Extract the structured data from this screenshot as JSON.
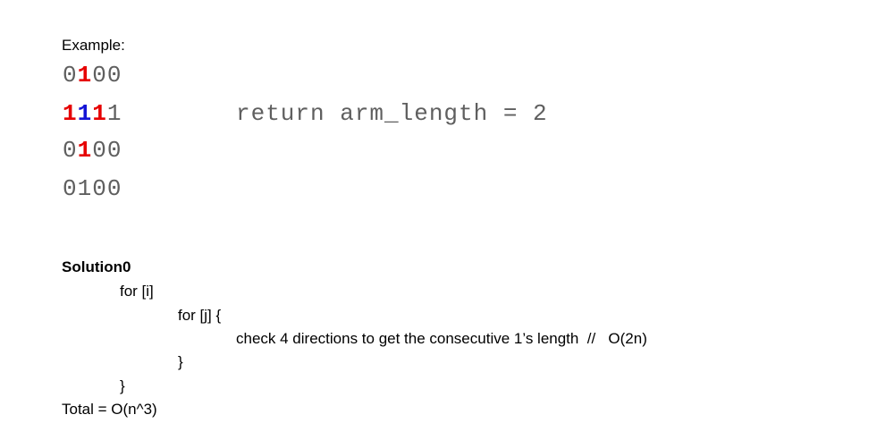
{
  "example": {
    "label": "Example:",
    "grid": [
      [
        {
          "v": "0",
          "c": "gray"
        },
        {
          "v": "1",
          "c": "red"
        },
        {
          "v": "0",
          "c": "gray"
        },
        {
          "v": "0",
          "c": "gray"
        }
      ],
      [
        {
          "v": "1",
          "c": "red"
        },
        {
          "v": "1",
          "c": "blue"
        },
        {
          "v": "1",
          "c": "red"
        },
        {
          "v": "1",
          "c": "gray"
        }
      ],
      [
        {
          "v": "0",
          "c": "gray"
        },
        {
          "v": "1",
          "c": "red"
        },
        {
          "v": "0",
          "c": "gray"
        },
        {
          "v": "0",
          "c": "gray"
        }
      ],
      [
        {
          "v": "0",
          "c": "gray"
        },
        {
          "v": "1",
          "c": "gray"
        },
        {
          "v": "0",
          "c": "gray"
        },
        {
          "v": "0",
          "c": "gray"
        }
      ]
    ],
    "return_text": "return arm_length = 2"
  },
  "colors": {
    "gray": "#5f5f5f",
    "red": "#e60000",
    "blue": "#1414d6"
  },
  "solution": {
    "title": "Solution0",
    "lines": [
      "for [i]",
      "for [j] {",
      "check 4 directions to get the consecutive 1’s length  //   O(2n)",
      "}",
      "}"
    ],
    "total": "Total = O(n^3)"
  }
}
